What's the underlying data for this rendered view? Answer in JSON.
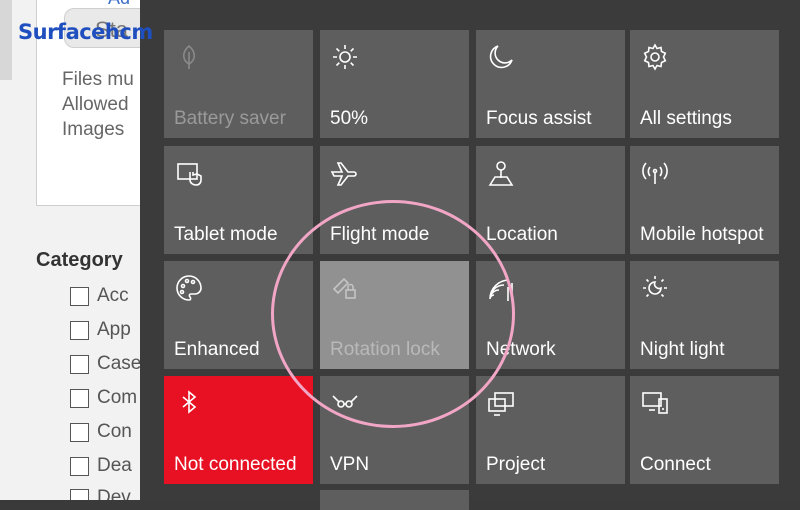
{
  "background_page": {
    "button_text": "Sta",
    "link_text": "Ad",
    "lines": [
      "Files mu",
      "Allowed",
      "Images"
    ],
    "category_heading": "Category",
    "checkboxes": [
      "Acc",
      "App",
      "Case",
      "Com",
      "Con",
      "Dea",
      "Dev"
    ]
  },
  "watermark": {
    "brand": "Surfacehcm",
    "color": "#1f4fbf"
  },
  "action_center": {
    "tiles": [
      {
        "label": "Battery saver",
        "icon": "leaf-icon",
        "state": "disabled"
      },
      {
        "label": "50%",
        "icon": "brightness-icon",
        "state": "normal"
      },
      {
        "label": "Focus assist",
        "icon": "moon-icon",
        "state": "normal"
      },
      {
        "label": "All settings",
        "icon": "gear-icon",
        "state": "normal"
      },
      {
        "label": "Tablet mode",
        "icon": "tablet-icon",
        "state": "normal"
      },
      {
        "label": "Flight mode",
        "icon": "airplane-icon",
        "state": "normal"
      },
      {
        "label": "Location",
        "icon": "location-icon",
        "state": "normal"
      },
      {
        "label": "Mobile hotspot",
        "icon": "hotspot-icon",
        "state": "normal"
      },
      {
        "label": "Enhanced",
        "icon": "palette-icon",
        "state": "normal"
      },
      {
        "label": "Rotation lock",
        "icon": "rotation-lock-icon",
        "state": "active"
      },
      {
        "label": "Network",
        "icon": "network-icon",
        "state": "normal"
      },
      {
        "label": "Night light",
        "icon": "night-light-icon",
        "state": "normal"
      },
      {
        "label": "Not connected",
        "icon": "bluetooth-icon",
        "state": "red"
      },
      {
        "label": "VPN",
        "icon": "vpn-icon",
        "state": "normal"
      },
      {
        "label": "Project",
        "icon": "project-icon",
        "state": "normal"
      },
      {
        "label": "Connect",
        "icon": "connect-icon",
        "state": "normal"
      }
    ],
    "colors": {
      "tile": "#5e5e5e",
      "active_tile": "#919191",
      "bluetooth_off": "#e81123",
      "highlight_circle": "#f2a6c6"
    }
  }
}
